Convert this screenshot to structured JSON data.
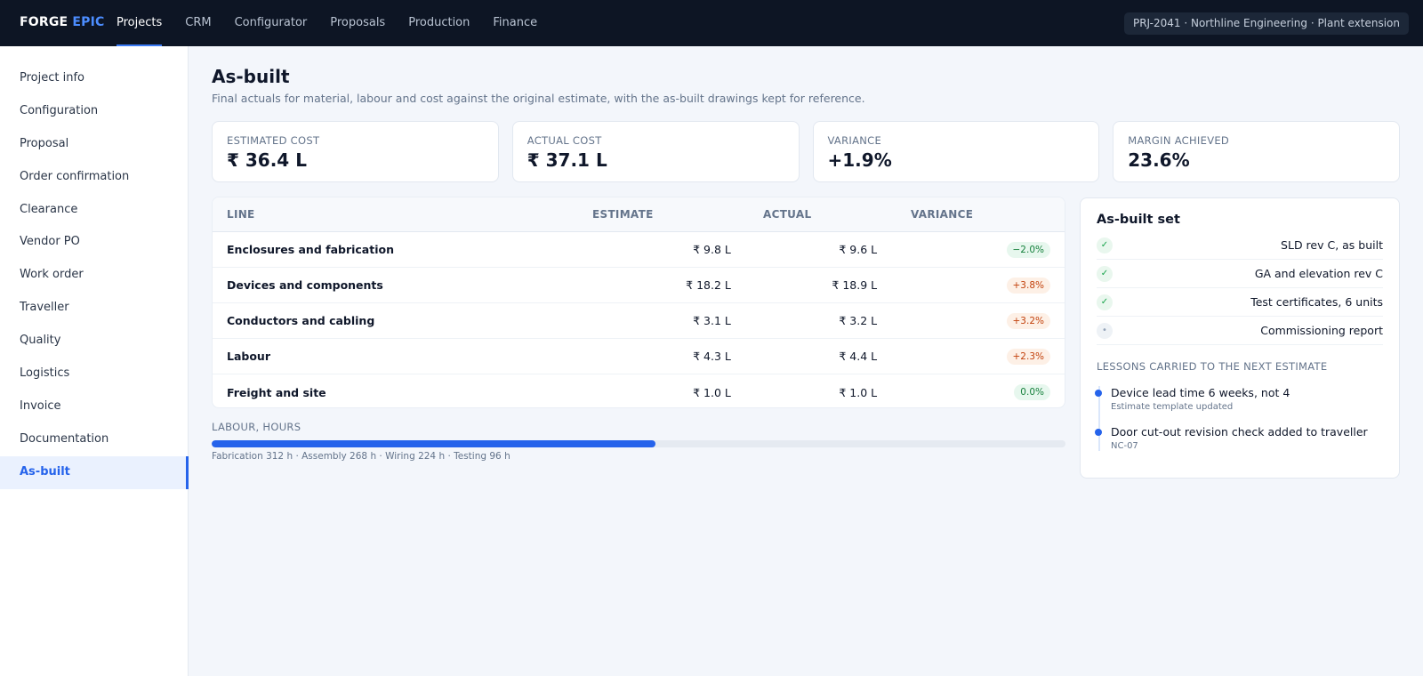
{
  "app": {
    "brand_main": "FORGE",
    "brand_accent": "EPIC",
    "accent_color": "#2563eb"
  },
  "topnav": [
    {
      "label": "Projects",
      "active": true
    },
    {
      "label": "CRM"
    },
    {
      "label": "Configurator"
    },
    {
      "label": "Proposals"
    },
    {
      "label": "Production"
    },
    {
      "label": "Finance"
    }
  ],
  "project_pill": "PRJ-2041 · Northline Engineering · Plant extension",
  "sidebar": [
    {
      "label": "Project info"
    },
    {
      "label": "Configuration"
    },
    {
      "label": "Proposal"
    },
    {
      "label": "Order confirmation"
    },
    {
      "label": "Clearance"
    },
    {
      "label": "Vendor PO"
    },
    {
      "label": "Work order"
    },
    {
      "label": "Traveller"
    },
    {
      "label": "Quality"
    },
    {
      "label": "Logistics"
    },
    {
      "label": "Invoice"
    },
    {
      "label": "Documentation"
    },
    {
      "label": "As-built",
      "active": true
    }
  ],
  "page": {
    "title": "As-built",
    "subtitle": "Final actuals for material, labour and cost against the original estimate, with the as-built drawings kept for reference."
  },
  "kpis": [
    {
      "label": "Estimated cost",
      "value": "₹ 36.4 L"
    },
    {
      "label": "Actual cost",
      "value": "₹ 37.1 L"
    },
    {
      "label": "Variance",
      "value": "+1.9%"
    },
    {
      "label": "Margin achieved",
      "value": "23.6%"
    }
  ],
  "table": {
    "headers": {
      "line": "Line",
      "estimate": "Estimate",
      "actual": "Actual",
      "variance": "Variance"
    },
    "rows": [
      {
        "line": "Enclosures and fabrication",
        "estimate": "₹ 9.8 L",
        "actual": "₹ 9.6 L",
        "variance": "−2.0%",
        "tone": "neg"
      },
      {
        "line": "Devices and components",
        "estimate": "₹ 18.2 L",
        "actual": "₹ 18.9 L",
        "variance": "+3.8%",
        "tone": "pos"
      },
      {
        "line": "Conductors and cabling",
        "estimate": "₹ 3.1 L",
        "actual": "₹ 3.2 L",
        "variance": "+3.2%",
        "tone": "pos"
      },
      {
        "line": "Labour",
        "estimate": "₹ 4.3 L",
        "actual": "₹ 4.4 L",
        "variance": "+2.3%",
        "tone": "pos"
      },
      {
        "line": "Freight and site",
        "estimate": "₹ 1.0 L",
        "actual": "₹ 1.0 L",
        "variance": "0.0%",
        "tone": "zero"
      }
    ]
  },
  "labour": {
    "label": "Labour, hours",
    "fill_fraction": 0.52,
    "note": "Fabrication 312 h · Assembly 268 h · Wiring 224 h · Testing 96 h"
  },
  "asbuilt": {
    "title": "As-built set",
    "items": [
      {
        "label": "SLD rev C, as built",
        "done": true,
        "icon": "check-icon"
      },
      {
        "label": "GA and elevation rev C",
        "done": true,
        "icon": "check-icon"
      },
      {
        "label": "Test certificates, 6 units",
        "done": true,
        "icon": "check-icon"
      },
      {
        "label": "Commissioning report",
        "done": false,
        "icon": "pending-dot-icon"
      }
    ],
    "lessons_label": "Lessons carried to the next estimate",
    "lessons": [
      {
        "title": "Device lead time 6 weeks, not 4",
        "sub": "Estimate template updated"
      },
      {
        "title": "Door cut-out revision check added to traveller",
        "sub": "NC-07"
      }
    ]
  }
}
